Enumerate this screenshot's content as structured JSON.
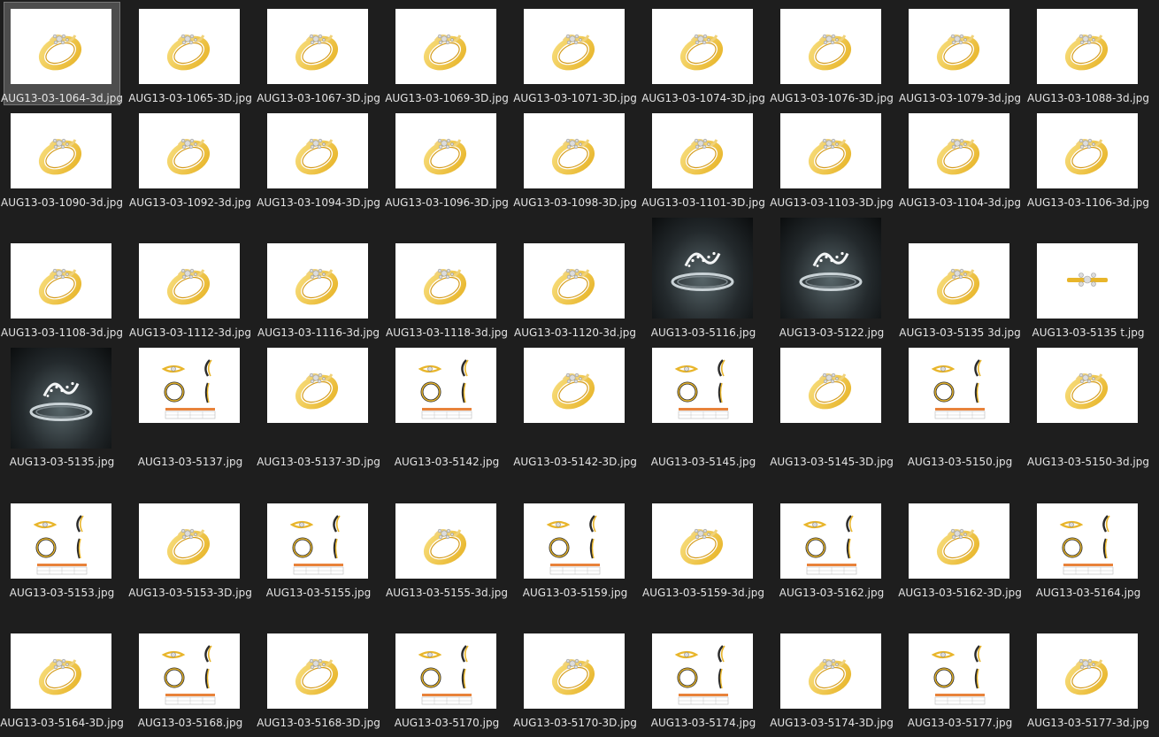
{
  "files": [
    {
      "name": "AUG13-03-1064-3d.jpg",
      "kind": "ring-gold",
      "selected": true
    },
    {
      "name": "AUG13-03-1065-3D.jpg",
      "kind": "ring-gold"
    },
    {
      "name": "AUG13-03-1067-3D.jpg",
      "kind": "ring-gold"
    },
    {
      "name": "AUG13-03-1069-3D.jpg",
      "kind": "ring-gold"
    },
    {
      "name": "AUG13-03-1071-3D.jpg",
      "kind": "ring-gold"
    },
    {
      "name": "AUG13-03-1074-3D.jpg",
      "kind": "ring-gold"
    },
    {
      "name": "AUG13-03-1076-3D.jpg",
      "kind": "ring-gold"
    },
    {
      "name": "AUG13-03-1079-3d.jpg",
      "kind": "ring-gold"
    },
    {
      "name": "AUG13-03-1088-3d.jpg",
      "kind": "ring-gold"
    },
    {
      "name": "AUG13-03-1090-3d.jpg",
      "kind": "ring-gold"
    },
    {
      "name": "AUG13-03-1092-3d.jpg",
      "kind": "ring-gold"
    },
    {
      "name": "AUG13-03-1094-3D.jpg",
      "kind": "ring-gold"
    },
    {
      "name": "AUG13-03-1096-3D.jpg",
      "kind": "ring-gold"
    },
    {
      "name": "AUG13-03-1098-3D.jpg",
      "kind": "ring-gold"
    },
    {
      "name": "AUG13-03-1101-3D.jpg",
      "kind": "ring-gold"
    },
    {
      "name": "AUG13-03-1103-3D.jpg",
      "kind": "ring-gold"
    },
    {
      "name": "AUG13-03-1104-3d.jpg",
      "kind": "ring-gold"
    },
    {
      "name": "AUG13-03-1106-3d.jpg",
      "kind": "ring-gold"
    },
    {
      "name": "AUG13-03-1108-3d.jpg",
      "kind": "ring-gold"
    },
    {
      "name": "AUG13-03-1112-3d.jpg",
      "kind": "ring-gold"
    },
    {
      "name": "AUG13-03-1116-3d.jpg",
      "kind": "ring-gold"
    },
    {
      "name": "AUG13-03-1118-3d.jpg",
      "kind": "ring-gold"
    },
    {
      "name": "AUG13-03-1120-3d.jpg",
      "kind": "ring-gold"
    },
    {
      "name": "AUG13-03-5116.jpg",
      "kind": "ring-dark"
    },
    {
      "name": "AUG13-03-5122.jpg",
      "kind": "ring-dark"
    },
    {
      "name": "AUG13-03-5135 3d.jpg",
      "kind": "ring-gold"
    },
    {
      "name": "AUG13-03-5135 t.jpg",
      "kind": "ring-top"
    },
    {
      "name": "AUG13-03-5135.jpg",
      "kind": "ring-dark"
    },
    {
      "name": "AUG13-03-5137.jpg",
      "kind": "sheet"
    },
    {
      "name": "AUG13-03-5137-3D.jpg",
      "kind": "ring-gold"
    },
    {
      "name": "AUG13-03-5142.jpg",
      "kind": "sheet"
    },
    {
      "name": "AUG13-03-5142-3D.jpg",
      "kind": "ring-gold"
    },
    {
      "name": "AUG13-03-5145.jpg",
      "kind": "sheet"
    },
    {
      "name": "AUG13-03-5145-3D.jpg",
      "kind": "ring-gold"
    },
    {
      "name": "AUG13-03-5150.jpg",
      "kind": "sheet"
    },
    {
      "name": "AUG13-03-5150-3d.jpg",
      "kind": "ring-gold"
    },
    {
      "name": "AUG13-03-5153.jpg",
      "kind": "sheet"
    },
    {
      "name": "AUG13-03-5153-3D.jpg",
      "kind": "ring-gold"
    },
    {
      "name": "AUG13-03-5155.jpg",
      "kind": "sheet"
    },
    {
      "name": "AUG13-03-5155-3d.jpg",
      "kind": "ring-gold"
    },
    {
      "name": "AUG13-03-5159.jpg",
      "kind": "sheet"
    },
    {
      "name": "AUG13-03-5159-3d.jpg",
      "kind": "ring-gold"
    },
    {
      "name": "AUG13-03-5162.jpg",
      "kind": "sheet"
    },
    {
      "name": "AUG13-03-5162-3D.jpg",
      "kind": "ring-gold"
    },
    {
      "name": "AUG13-03-5164.jpg",
      "kind": "sheet"
    },
    {
      "name": "AUG13-03-5164-3D.jpg",
      "kind": "ring-gold"
    },
    {
      "name": "AUG13-03-5168.jpg",
      "kind": "sheet"
    },
    {
      "name": "AUG13-03-5168-3D.jpg",
      "kind": "ring-gold"
    },
    {
      "name": "AUG13-03-5170.jpg",
      "kind": "sheet"
    },
    {
      "name": "AUG13-03-5170-3D.jpg",
      "kind": "ring-gold"
    },
    {
      "name": "AUG13-03-5174.jpg",
      "kind": "sheet"
    },
    {
      "name": "AUG13-03-5174-3D.jpg",
      "kind": "ring-gold"
    },
    {
      "name": "AUG13-03-5177.jpg",
      "kind": "sheet"
    },
    {
      "name": "AUG13-03-5177-3d.jpg",
      "kind": "ring-gold"
    }
  ],
  "colors": {
    "background": "#1e1e1e",
    "label": "#e4e4e4",
    "selection": "#4d4d4d",
    "gold": "#e8b52a",
    "gold_light": "#f7dc7a",
    "diamond": "#dcdcdc",
    "sheet_table": "#e8823a"
  }
}
